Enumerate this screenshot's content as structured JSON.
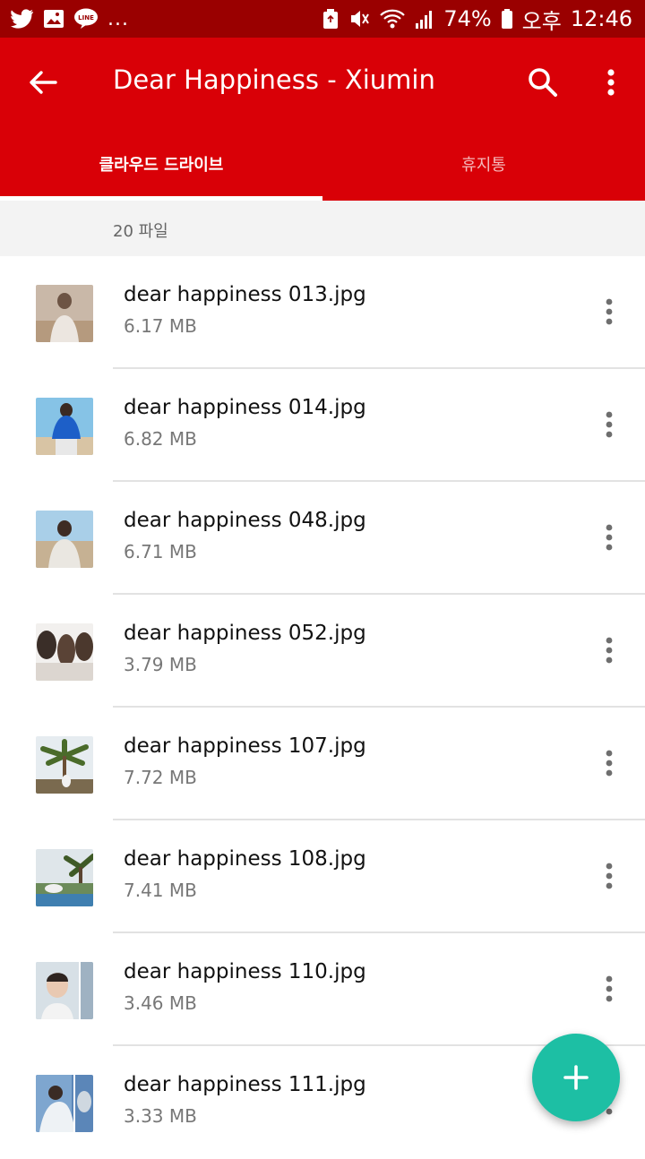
{
  "status_bar": {
    "battery_percent": "74%",
    "ampm": "오후",
    "time": "12:46",
    "more": "...",
    "icons": [
      "twitter-icon",
      "image-icon",
      "line-icon",
      "recycle-icon",
      "mute-icon",
      "wifi-icon",
      "signal-icon",
      "battery-icon"
    ]
  },
  "toolbar": {
    "title": "Dear Happiness - Xiumin",
    "icons": [
      "back-arrow-icon",
      "search-icon",
      "more-vert-icon"
    ]
  },
  "tabs": [
    {
      "label": "클라우드 드라이브",
      "selected": true
    },
    {
      "label": "휴지통",
      "selected": false
    }
  ],
  "file_count": "20 파일",
  "files": [
    {
      "name": "dear happiness 013.jpg",
      "size": "6.17 MB"
    },
    {
      "name": "dear happiness 014.jpg",
      "size": "6.82 MB"
    },
    {
      "name": "dear happiness 048.jpg",
      "size": "6.71 MB"
    },
    {
      "name": "dear happiness 052.jpg",
      "size": "3.79 MB"
    },
    {
      "name": "dear happiness 107.jpg",
      "size": "7.72 MB"
    },
    {
      "name": "dear happiness 108.jpg",
      "size": "7.41 MB"
    },
    {
      "name": "dear happiness 110.jpg",
      "size": "3.46 MB"
    },
    {
      "name": "dear happiness 111.jpg",
      "size": "3.33 MB"
    }
  ],
  "fab": {
    "icon": "plus-icon"
  },
  "colors": {
    "status_bar": "#9a0000",
    "app_bar": "#d90007",
    "fab": "#1dbfa4"
  }
}
